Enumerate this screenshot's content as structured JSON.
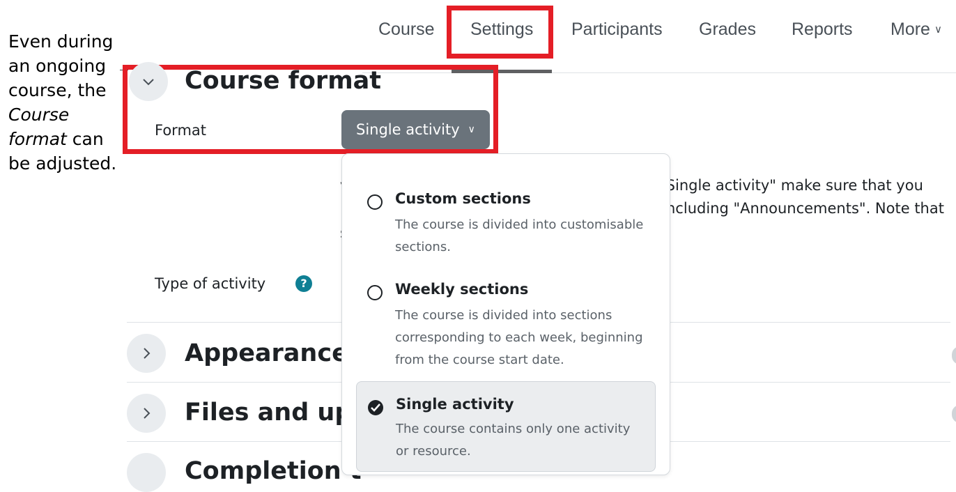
{
  "caption": {
    "part1": "Even during an ongoing course, the ",
    "italic": "Course format",
    "part2": " can be adjusted."
  },
  "nav": {
    "tabs": [
      "Course",
      "Settings",
      "Participants",
      "Grades",
      "Reports",
      "More"
    ],
    "active": "Settings"
  },
  "sections": {
    "course_format": "Course format",
    "appearance": "Appearance",
    "files": "Files and upl",
    "completion": "Completion t"
  },
  "format_field": {
    "label": "Format",
    "selected": "Single activity"
  },
  "type_of_activity_label": "Type of activity",
  "help_icon_glyph": "?",
  "background_text": {
    "line1_start": "v",
    "line1_end": "\"Single activity\" make sure that you",
    "line2_end": "ncluding \"Announcements\". Note that",
    "line3_start": "s"
  },
  "dropdown_options": [
    {
      "title": "Custom sections",
      "description": "The course is divided into customisable sections.",
      "selected": false
    },
    {
      "title": "Weekly sections",
      "description": "The course is divided into sections corresponding to each week, beginning from the course start date.",
      "selected": false
    },
    {
      "title": "Single activity",
      "description": "The course contains only one activity or resource.",
      "selected": true
    }
  ],
  "colors": {
    "highlight": "#e41e26",
    "select_bg": "#6a737b",
    "help_icon": "#0f7f94"
  }
}
